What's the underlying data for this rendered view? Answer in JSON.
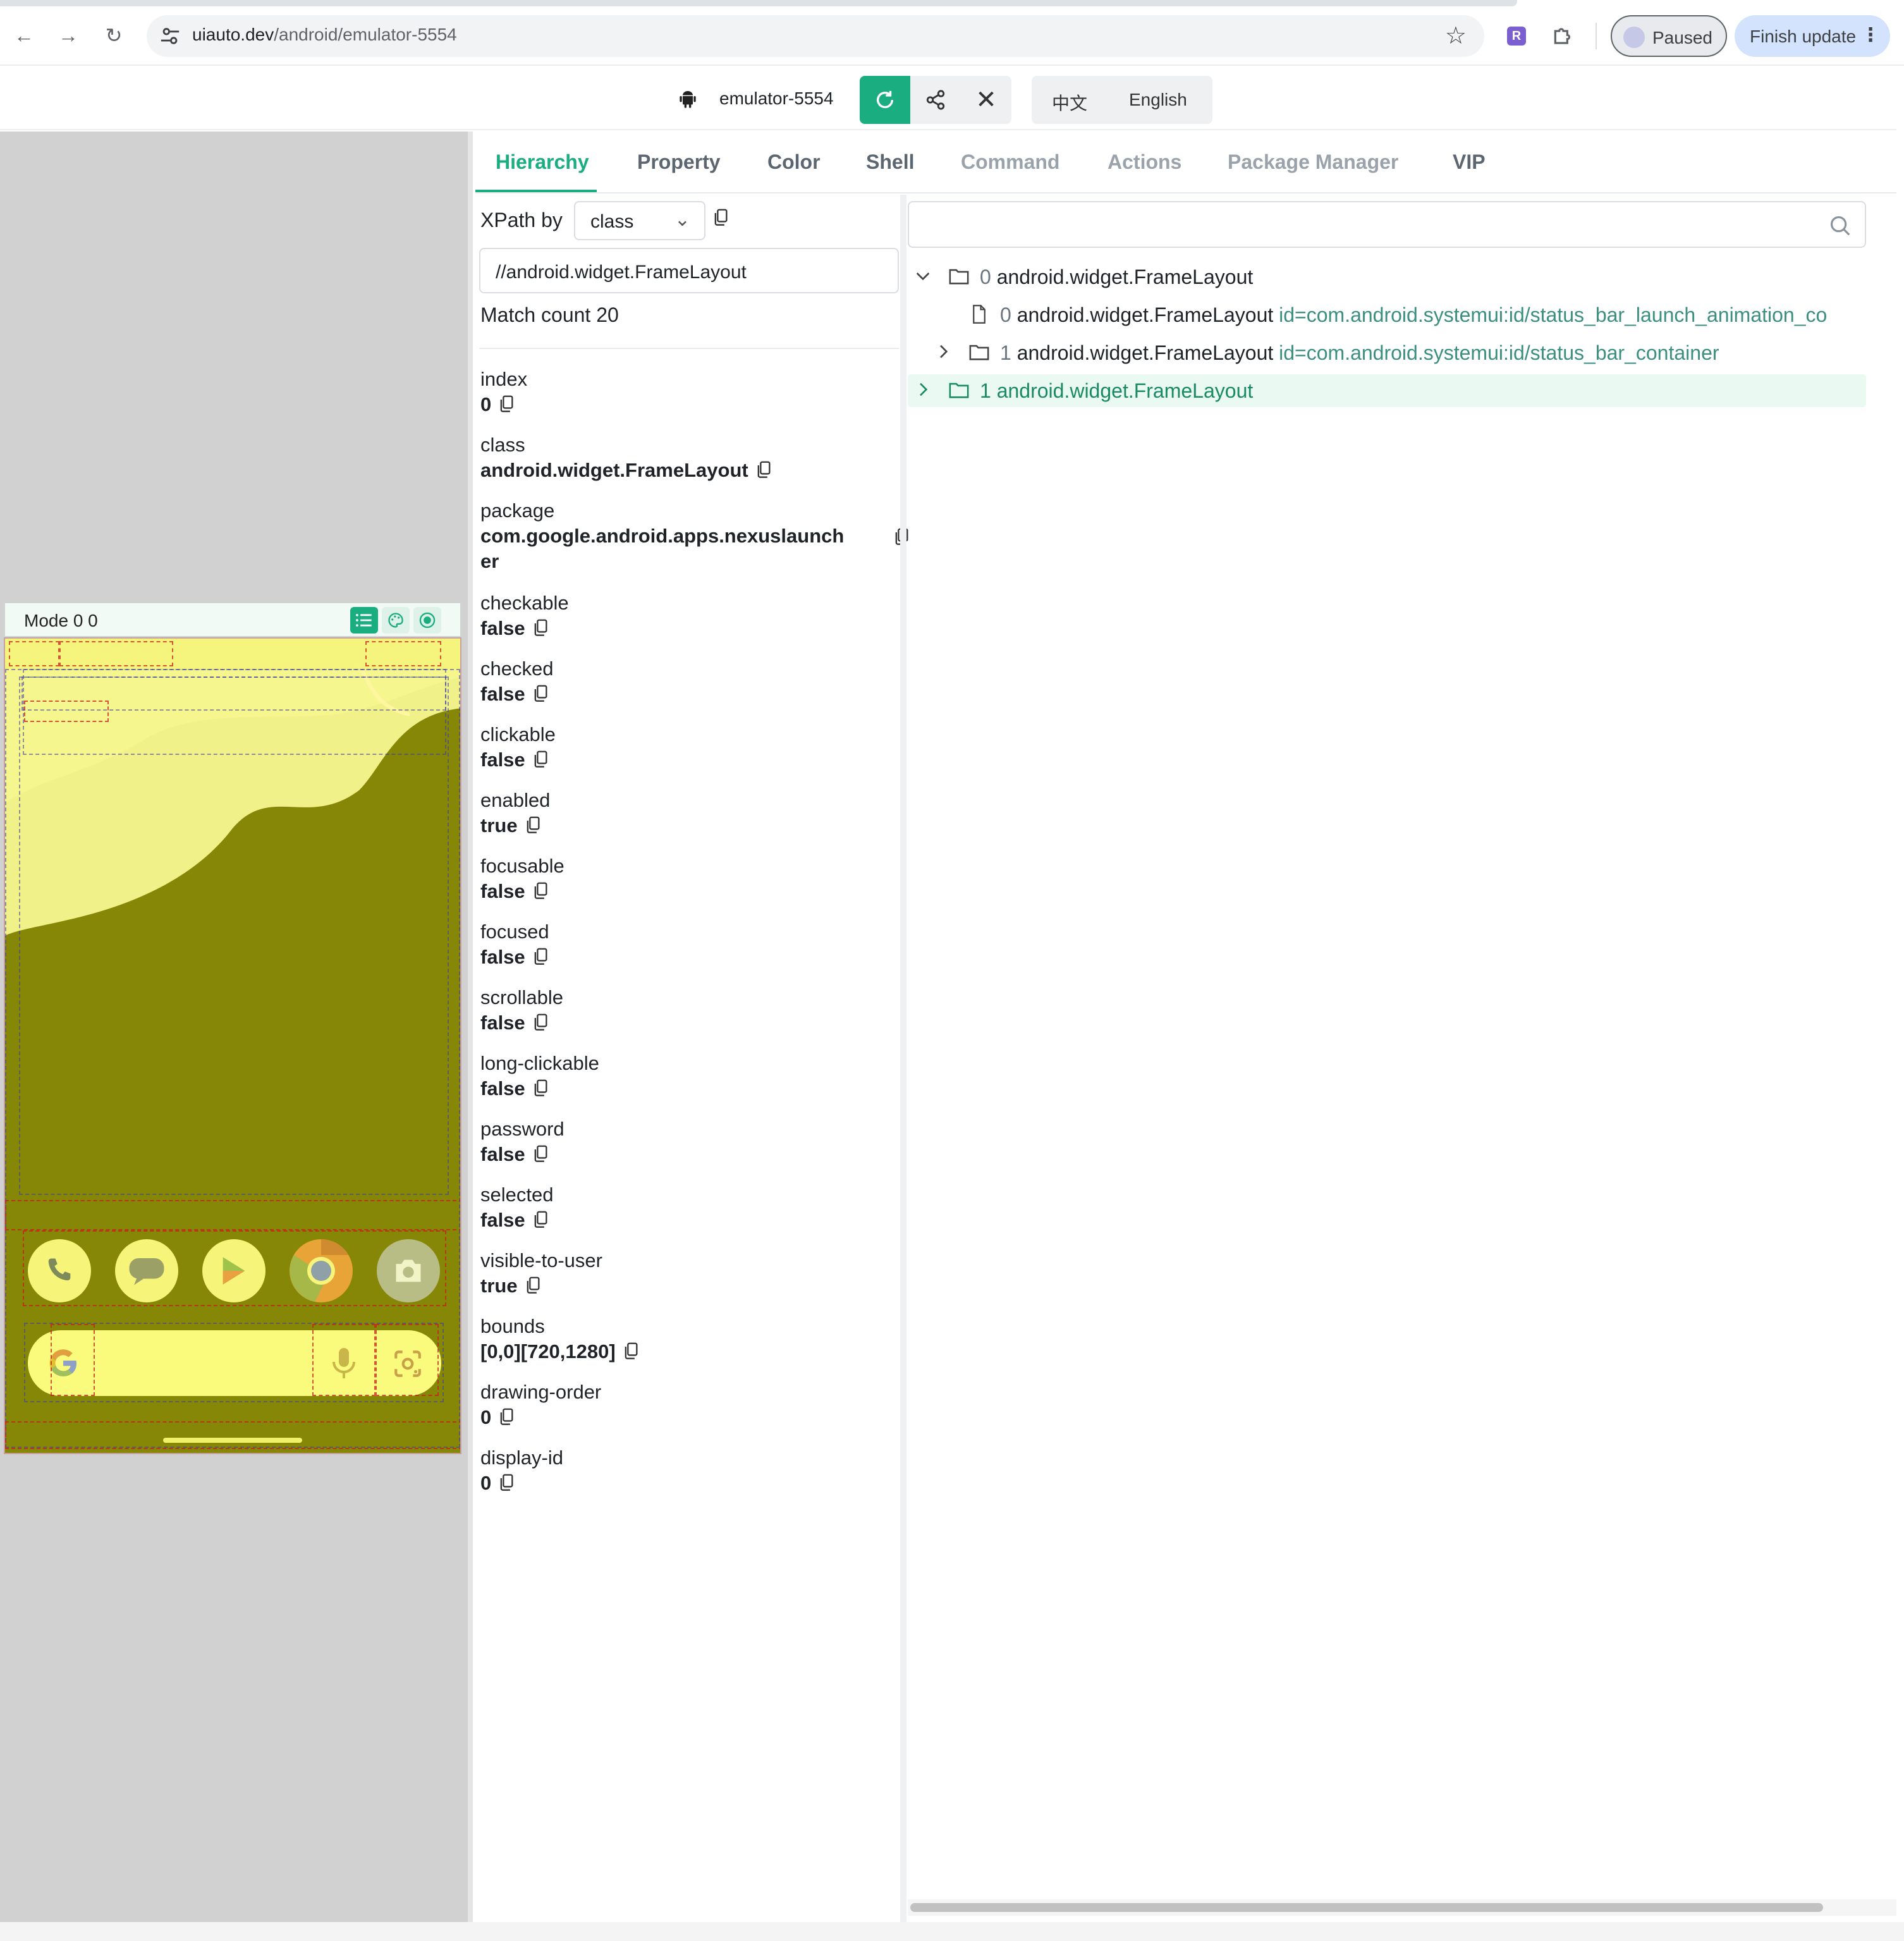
{
  "browser": {
    "url_host": "uiauto.dev",
    "url_path": "/android/emulator-5554",
    "profile_label": "Paused",
    "update_label": "Finish update",
    "extension_badge": "R"
  },
  "header": {
    "device_name": "emulator-5554",
    "lang_zh": "中文",
    "lang_en": "English",
    "accent_color": "#1aad80"
  },
  "phone": {
    "mode_text": "Mode 0 0",
    "overlay_color": "#f7f76b",
    "dock_apps": [
      "phone-icon",
      "messages-icon",
      "play-store-icon",
      "chrome-icon",
      "camera-icon"
    ]
  },
  "tabs": [
    "Hierarchy",
    "Property",
    "Color",
    "Shell",
    "Command",
    "Actions",
    "Package Manager",
    "VIP"
  ],
  "active_tab": "Hierarchy",
  "xpath": {
    "label": "XPath by",
    "by": "class",
    "value": "//android.widget.FrameLayout",
    "match_text": "Match count 20"
  },
  "properties": [
    {
      "key": "index",
      "value": "0"
    },
    {
      "key": "class",
      "value": "android.widget.FrameLayout"
    },
    {
      "key": "package",
      "value": "com.google.android.apps.nexuslaunch",
      "value2": "er"
    },
    {
      "key": "checkable",
      "value": "false"
    },
    {
      "key": "checked",
      "value": "false"
    },
    {
      "key": "clickable",
      "value": "false"
    },
    {
      "key": "enabled",
      "value": "true"
    },
    {
      "key": "focusable",
      "value": "false"
    },
    {
      "key": "focused",
      "value": "false"
    },
    {
      "key": "scrollable",
      "value": "false"
    },
    {
      "key": "long-clickable",
      "value": "false"
    },
    {
      "key": "password",
      "value": "false"
    },
    {
      "key": "selected",
      "value": "false"
    },
    {
      "key": "visible-to-user",
      "value": "true"
    },
    {
      "key": "bounds",
      "value": "[0,0][720,1280]"
    },
    {
      "key": "drawing-order",
      "value": "0"
    },
    {
      "key": "display-id",
      "value": "0"
    }
  ],
  "tree": [
    {
      "index": "0",
      "cls": "android.widget.FrameLayout",
      "attr": ""
    },
    {
      "index": "0",
      "cls": "android.widget.FrameLayout",
      "attr": "id=com.android.systemui:id/status_bar_launch_animation_co"
    },
    {
      "index": "1",
      "cls": "android.widget.FrameLayout",
      "attr": "id=com.android.systemui:id/status_bar_container"
    },
    {
      "index": "1",
      "cls": "android.widget.FrameLayout",
      "attr": ""
    }
  ]
}
